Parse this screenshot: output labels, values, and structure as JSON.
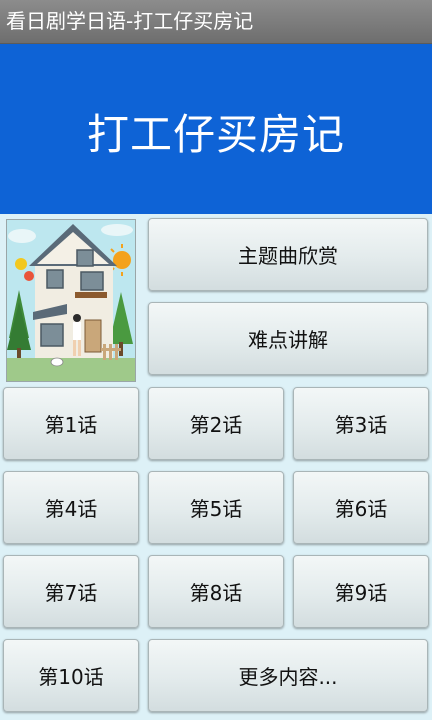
{
  "titlebar": {
    "text": "看日剧学日语-打工仔买房记"
  },
  "banner": {
    "title": "打工仔买房记"
  },
  "buttons": {
    "theme_song": "主题曲欣赏",
    "difficulties": "难点讲解",
    "ep1": "第1话",
    "ep2": "第2话",
    "ep3": "第3话",
    "ep4": "第4话",
    "ep5": "第5话",
    "ep6": "第6话",
    "ep7": "第7话",
    "ep8": "第8话",
    "ep9": "第9话",
    "ep10": "第10话",
    "more": "更多内容..."
  },
  "colors": {
    "titlebar_bg": "#7d7d7d",
    "banner_bg": "#0e63d6",
    "page_bg": "#ddf1f7"
  }
}
